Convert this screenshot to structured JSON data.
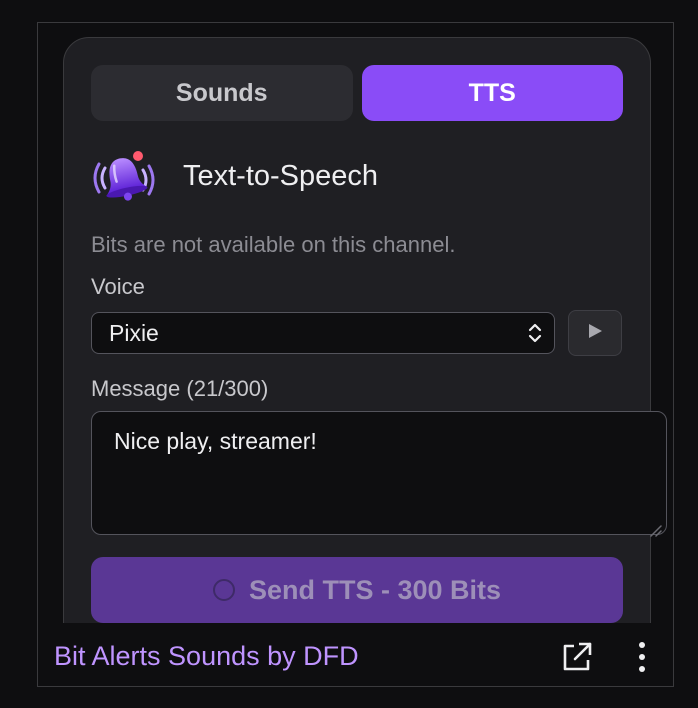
{
  "tabs": {
    "sounds_label": "Sounds",
    "tts_label": "TTS",
    "active": "TTS"
  },
  "panel": {
    "title": "Text-to-Speech",
    "notice": "Bits are not available on this channel.",
    "voice_label": "Voice",
    "voice_value": "Pixie",
    "message_label": "Message (21/300)",
    "message_value": "Nice play, streamer!",
    "send_label": "Send TTS - 300 Bits"
  },
  "footer": {
    "extension_name": "Bit Alerts Sounds by DFD"
  },
  "icons": {
    "header": "bell-icon",
    "voice_select": "chevron-up-down-icon",
    "play": "play-icon",
    "popout": "popout-icon",
    "menu": "kebab-menu-icon"
  },
  "colors": {
    "accent": "#8a4cf7",
    "send_button": "#5a3795",
    "link": "#bf94ff",
    "panel_bg": "#1f1f23",
    "page_bg": "#0e0e10"
  }
}
